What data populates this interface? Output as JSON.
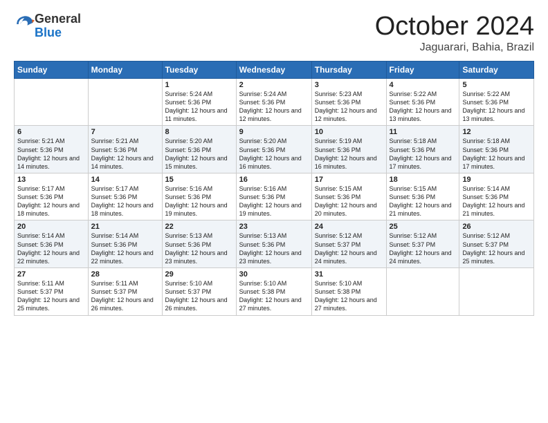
{
  "logo": {
    "general": "General",
    "blue": "Blue"
  },
  "header": {
    "month": "October 2024",
    "location": "Jaguarari, Bahia, Brazil"
  },
  "days_of_week": [
    "Sunday",
    "Monday",
    "Tuesday",
    "Wednesday",
    "Thursday",
    "Friday",
    "Saturday"
  ],
  "weeks": [
    [
      {
        "day": "",
        "sunrise": "",
        "sunset": "",
        "daylight": ""
      },
      {
        "day": "",
        "sunrise": "",
        "sunset": "",
        "daylight": ""
      },
      {
        "day": "1",
        "sunrise": "Sunrise: 5:24 AM",
        "sunset": "Sunset: 5:36 PM",
        "daylight": "Daylight: 12 hours and 11 minutes."
      },
      {
        "day": "2",
        "sunrise": "Sunrise: 5:24 AM",
        "sunset": "Sunset: 5:36 PM",
        "daylight": "Daylight: 12 hours and 12 minutes."
      },
      {
        "day": "3",
        "sunrise": "Sunrise: 5:23 AM",
        "sunset": "Sunset: 5:36 PM",
        "daylight": "Daylight: 12 hours and 12 minutes."
      },
      {
        "day": "4",
        "sunrise": "Sunrise: 5:22 AM",
        "sunset": "Sunset: 5:36 PM",
        "daylight": "Daylight: 12 hours and 13 minutes."
      },
      {
        "day": "5",
        "sunrise": "Sunrise: 5:22 AM",
        "sunset": "Sunset: 5:36 PM",
        "daylight": "Daylight: 12 hours and 13 minutes."
      }
    ],
    [
      {
        "day": "6",
        "sunrise": "Sunrise: 5:21 AM",
        "sunset": "Sunset: 5:36 PM",
        "daylight": "Daylight: 12 hours and 14 minutes."
      },
      {
        "day": "7",
        "sunrise": "Sunrise: 5:21 AM",
        "sunset": "Sunset: 5:36 PM",
        "daylight": "Daylight: 12 hours and 14 minutes."
      },
      {
        "day": "8",
        "sunrise": "Sunrise: 5:20 AM",
        "sunset": "Sunset: 5:36 PM",
        "daylight": "Daylight: 12 hours and 15 minutes."
      },
      {
        "day": "9",
        "sunrise": "Sunrise: 5:20 AM",
        "sunset": "Sunset: 5:36 PM",
        "daylight": "Daylight: 12 hours and 16 minutes."
      },
      {
        "day": "10",
        "sunrise": "Sunrise: 5:19 AM",
        "sunset": "Sunset: 5:36 PM",
        "daylight": "Daylight: 12 hours and 16 minutes."
      },
      {
        "day": "11",
        "sunrise": "Sunrise: 5:18 AM",
        "sunset": "Sunset: 5:36 PM",
        "daylight": "Daylight: 12 hours and 17 minutes."
      },
      {
        "day": "12",
        "sunrise": "Sunrise: 5:18 AM",
        "sunset": "Sunset: 5:36 PM",
        "daylight": "Daylight: 12 hours and 17 minutes."
      }
    ],
    [
      {
        "day": "13",
        "sunrise": "Sunrise: 5:17 AM",
        "sunset": "Sunset: 5:36 PM",
        "daylight": "Daylight: 12 hours and 18 minutes."
      },
      {
        "day": "14",
        "sunrise": "Sunrise: 5:17 AM",
        "sunset": "Sunset: 5:36 PM",
        "daylight": "Daylight: 12 hours and 18 minutes."
      },
      {
        "day": "15",
        "sunrise": "Sunrise: 5:16 AM",
        "sunset": "Sunset: 5:36 PM",
        "daylight": "Daylight: 12 hours and 19 minutes."
      },
      {
        "day": "16",
        "sunrise": "Sunrise: 5:16 AM",
        "sunset": "Sunset: 5:36 PM",
        "daylight": "Daylight: 12 hours and 19 minutes."
      },
      {
        "day": "17",
        "sunrise": "Sunrise: 5:15 AM",
        "sunset": "Sunset: 5:36 PM",
        "daylight": "Daylight: 12 hours and 20 minutes."
      },
      {
        "day": "18",
        "sunrise": "Sunrise: 5:15 AM",
        "sunset": "Sunset: 5:36 PM",
        "daylight": "Daylight: 12 hours and 21 minutes."
      },
      {
        "day": "19",
        "sunrise": "Sunrise: 5:14 AM",
        "sunset": "Sunset: 5:36 PM",
        "daylight": "Daylight: 12 hours and 21 minutes."
      }
    ],
    [
      {
        "day": "20",
        "sunrise": "Sunrise: 5:14 AM",
        "sunset": "Sunset: 5:36 PM",
        "daylight": "Daylight: 12 hours and 22 minutes."
      },
      {
        "day": "21",
        "sunrise": "Sunrise: 5:14 AM",
        "sunset": "Sunset: 5:36 PM",
        "daylight": "Daylight: 12 hours and 22 minutes."
      },
      {
        "day": "22",
        "sunrise": "Sunrise: 5:13 AM",
        "sunset": "Sunset: 5:36 PM",
        "daylight": "Daylight: 12 hours and 23 minutes."
      },
      {
        "day": "23",
        "sunrise": "Sunrise: 5:13 AM",
        "sunset": "Sunset: 5:36 PM",
        "daylight": "Daylight: 12 hours and 23 minutes."
      },
      {
        "day": "24",
        "sunrise": "Sunrise: 5:12 AM",
        "sunset": "Sunset: 5:37 PM",
        "daylight": "Daylight: 12 hours and 24 minutes."
      },
      {
        "day": "25",
        "sunrise": "Sunrise: 5:12 AM",
        "sunset": "Sunset: 5:37 PM",
        "daylight": "Daylight: 12 hours and 24 minutes."
      },
      {
        "day": "26",
        "sunrise": "Sunrise: 5:12 AM",
        "sunset": "Sunset: 5:37 PM",
        "daylight": "Daylight: 12 hours and 25 minutes."
      }
    ],
    [
      {
        "day": "27",
        "sunrise": "Sunrise: 5:11 AM",
        "sunset": "Sunset: 5:37 PM",
        "daylight": "Daylight: 12 hours and 25 minutes."
      },
      {
        "day": "28",
        "sunrise": "Sunrise: 5:11 AM",
        "sunset": "Sunset: 5:37 PM",
        "daylight": "Daylight: 12 hours and 26 minutes."
      },
      {
        "day": "29",
        "sunrise": "Sunrise: 5:10 AM",
        "sunset": "Sunset: 5:37 PM",
        "daylight": "Daylight: 12 hours and 26 minutes."
      },
      {
        "day": "30",
        "sunrise": "Sunrise: 5:10 AM",
        "sunset": "Sunset: 5:38 PM",
        "daylight": "Daylight: 12 hours and 27 minutes."
      },
      {
        "day": "31",
        "sunrise": "Sunrise: 5:10 AM",
        "sunset": "Sunset: 5:38 PM",
        "daylight": "Daylight: 12 hours and 27 minutes."
      },
      {
        "day": "",
        "sunrise": "",
        "sunset": "",
        "daylight": ""
      },
      {
        "day": "",
        "sunrise": "",
        "sunset": "",
        "daylight": ""
      }
    ]
  ]
}
